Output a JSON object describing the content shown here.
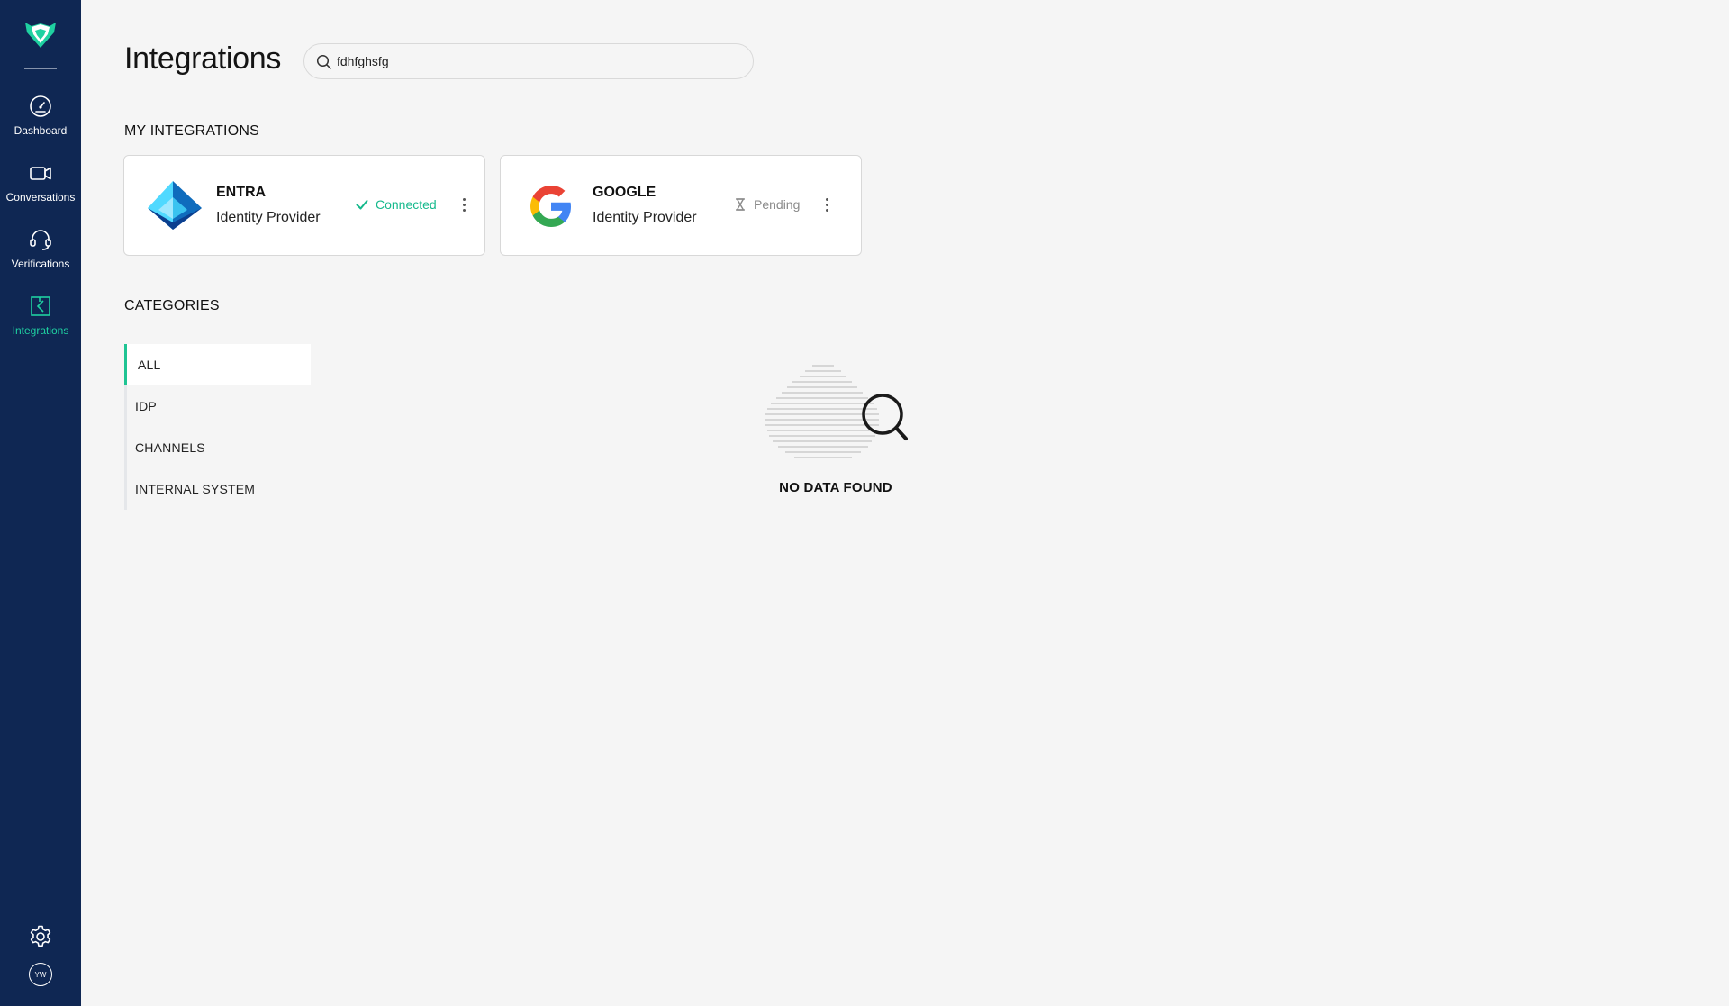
{
  "sidebar": {
    "items": [
      {
        "label": "Dashboard",
        "icon": "dashboard-gauge-icon"
      },
      {
        "label": "Conversations",
        "icon": "video-camera-icon"
      },
      {
        "label": "Verifications",
        "icon": "headset-icon"
      },
      {
        "label": "Integrations",
        "icon": "integrations-icon",
        "active": true
      }
    ],
    "settings_icon": "gear-icon",
    "avatar_initials": "YW"
  },
  "header": {
    "title": "Integrations",
    "search": {
      "value": "fdhfghsfg",
      "icon": "search-icon"
    }
  },
  "my_integrations": {
    "title": "MY INTEGRATIONS",
    "cards": [
      {
        "name": "ENTRA",
        "type": "Identity Provider",
        "status": "Connected",
        "status_icon": "check-icon",
        "status_color": "#15b98c"
      },
      {
        "name": "GOOGLE",
        "type": "Identity Provider",
        "status": "Pending",
        "status_icon": "hourglass-icon",
        "status_color": "#8a8a8a"
      }
    ]
  },
  "categories": {
    "title": "CATEGORIES",
    "items": [
      "ALL",
      "IDP",
      "CHANNELS",
      "INTERNAL SYSTEM"
    ],
    "selected": "ALL"
  },
  "empty_state": {
    "text": "NO DATA FOUND"
  },
  "colors": {
    "sidebar_bg": "#0f2753",
    "accent": "#1fd1a1",
    "background": "#f5f5f5"
  }
}
